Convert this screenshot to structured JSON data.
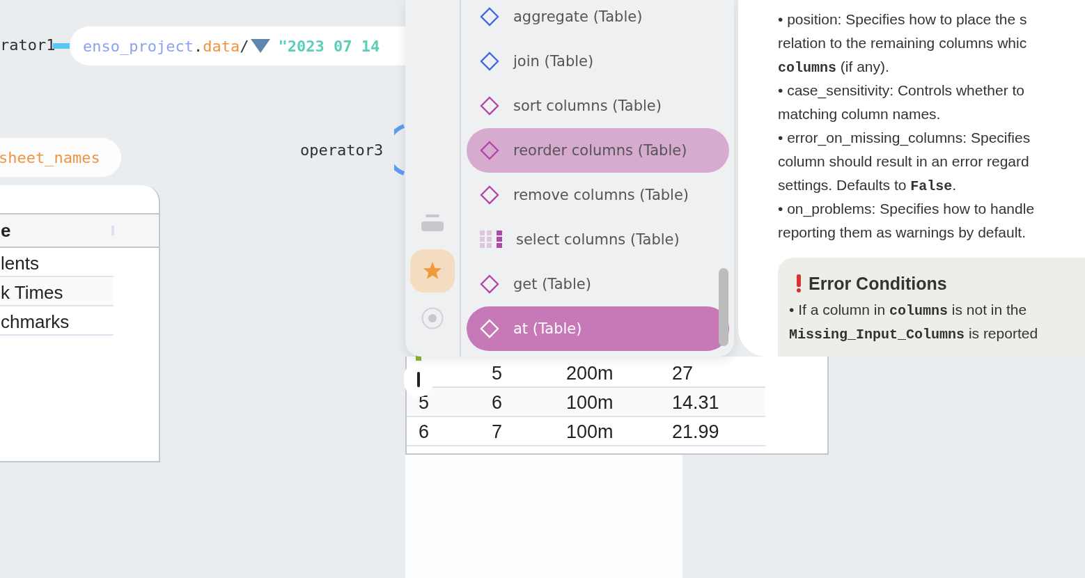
{
  "graph": {
    "node1_label": "rator1",
    "data_node": {
      "segments": [
        {
          "text": "enso_project",
          "kind": "module"
        },
        {
          "text": ".",
          "kind": "punct"
        },
        {
          "text": "data",
          "kind": "method"
        },
        {
          "text": "/",
          "kind": "punct"
        },
        {
          "kind": "dropdown"
        },
        {
          "text": "\"2023 07 14",
          "kind": "string"
        }
      ]
    },
    "sheet_names_node": "sheet_names",
    "node3_label": "operator3"
  },
  "sheet_table": {
    "header": "e",
    "rows": [
      "lents",
      "k Times",
      "chmarks"
    ]
  },
  "component_browser": {
    "sidebar": [
      {
        "kind": "stack",
        "selected": false
      },
      {
        "kind": "star",
        "selected": true
      },
      {
        "kind": "radio",
        "selected": false
      }
    ],
    "items": [
      {
        "label": "aggregate (Table)",
        "kind": "diamond",
        "color": "#3f68e0",
        "hovered": false,
        "selected": false
      },
      {
        "label": "join (Table)",
        "kind": "diamond",
        "color": "#3f68e0",
        "hovered": false,
        "selected": false
      },
      {
        "label": "sort columns (Table)",
        "kind": "diamond",
        "color": "#b048a8",
        "hovered": false,
        "selected": false
      },
      {
        "label": "reorder columns (Table)",
        "kind": "diamond",
        "color": "#b048a8",
        "hovered": true,
        "selected": false
      },
      {
        "label": "remove columns (Table)",
        "kind": "diamond",
        "color": "#b048a8",
        "hovered": false,
        "selected": false
      },
      {
        "label": "select columns (Table)",
        "kind": "grid",
        "color": "#b048a8",
        "hovered": false,
        "selected": false
      },
      {
        "label": "get (Table)",
        "kind": "diamond",
        "color": "#b048a8",
        "hovered": false,
        "selected": false
      },
      {
        "label": "at (Table)",
        "kind": "diamond",
        "hovered": false,
        "selected": true
      }
    ]
  },
  "documentation": {
    "lines": [
      [
        {
          "text": "• position: Specifies how to place the s",
          "kind": "text"
        }
      ],
      [
        {
          "text": "relation to the remaining columns whic",
          "kind": "text"
        }
      ],
      [
        {
          "text": "columns",
          "kind": "code"
        },
        {
          "text": " (if any).",
          "kind": "text"
        }
      ],
      [
        {
          "text": "• case_sensitivity: Controls whether to",
          "kind": "text"
        }
      ],
      [
        {
          "text": "matching column names.",
          "kind": "text"
        }
      ],
      [
        {
          "text": "• error_on_missing_columns: Specifies",
          "kind": "text"
        }
      ],
      [
        {
          "text": "column should result in an error regard",
          "kind": "text"
        }
      ],
      [
        {
          "text": "settings. Defaults to ",
          "kind": "text"
        },
        {
          "text": "False",
          "kind": "code"
        },
        {
          "text": ".",
          "kind": "text"
        }
      ],
      [
        {
          "text": "• on_problems: Specifies how to handle",
          "kind": "text"
        }
      ],
      [
        {
          "text": "reporting them as warnings by default.",
          "kind": "text"
        }
      ]
    ],
    "error_box": {
      "title": "Error Conditions",
      "lines": [
        [
          {
            "text": "• If a column in ",
            "kind": "text"
          },
          {
            "text": "columns",
            "kind": "code"
          },
          {
            "text": " is not in the",
            "kind": "text"
          }
        ],
        [
          {
            "text": "Missing_Input_Columns",
            "kind": "code"
          },
          {
            "text": " is reported",
            "kind": "text"
          }
        ]
      ]
    }
  },
  "result_table": {
    "rows": [
      {
        "cells": [
          "5",
          "200m",
          "27"
        ]
      },
      {
        "index": "5",
        "cells": [
          "6",
          "100m",
          "14.31"
        ]
      },
      {
        "index": "6",
        "cells": [
          "7",
          "100m",
          "21.99"
        ]
      }
    ]
  }
}
